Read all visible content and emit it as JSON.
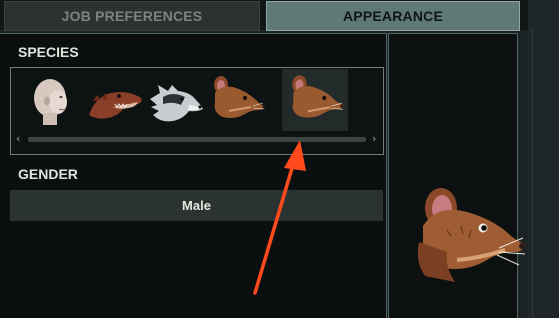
{
  "tabs": [
    {
      "label": "JOB PREFERENCES",
      "active": false
    },
    {
      "label": "APPEARANCE",
      "active": true
    }
  ],
  "species": {
    "label": "SPECIES",
    "options": [
      {
        "name": "human-icon"
      },
      {
        "name": "lizard-icon"
      },
      {
        "name": "wolf-icon"
      },
      {
        "name": "rat-icon"
      },
      {
        "name": "rat-icon-selected"
      }
    ],
    "selected_index": 4,
    "scroll_left": "‹",
    "scroll_right": "›"
  },
  "gender": {
    "label": "GENDER",
    "value": "Male"
  },
  "colors": {
    "accent": "#5f7a75",
    "annotation_arrow": "#ff4a1c"
  }
}
